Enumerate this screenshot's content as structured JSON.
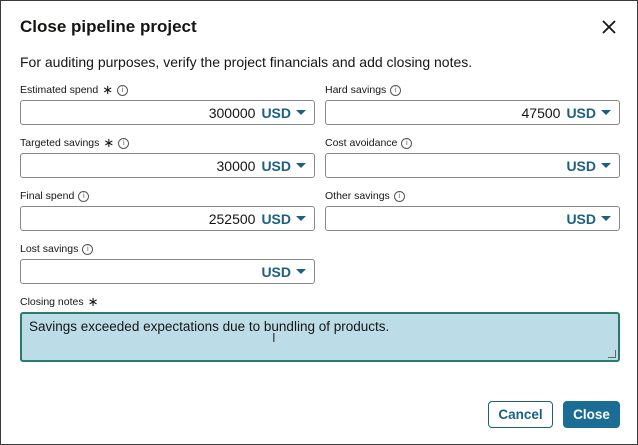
{
  "dialog": {
    "title": "Close pipeline project",
    "subtitle": "For auditing purposes, verify the project financials and add closing notes."
  },
  "fields": {
    "estimated_spend": {
      "label": "Estimated spend",
      "required": "∗",
      "value": "300000",
      "currency": "USD"
    },
    "hard_savings": {
      "label": "Hard savings",
      "value": "47500",
      "currency": "USD"
    },
    "targeted_savings": {
      "label": "Targeted savings",
      "required": "∗",
      "value": "30000",
      "currency": "USD"
    },
    "cost_avoidance": {
      "label": "Cost avoidance",
      "value": "",
      "currency": "USD"
    },
    "final_spend": {
      "label": "Final spend",
      "value": "252500",
      "currency": "USD"
    },
    "other_savings": {
      "label": "Other savings",
      "value": "",
      "currency": "USD"
    },
    "lost_savings": {
      "label": "Lost savings",
      "value": "",
      "currency": "USD"
    }
  },
  "notes": {
    "label": "Closing notes",
    "required": "∗",
    "value": "Savings exceeded expectations due to bundling of products."
  },
  "buttons": {
    "cancel": "Cancel",
    "close": "Close"
  },
  "icons": {
    "info": "i"
  },
  "colors": {
    "accent": "#1b5f83",
    "primary_button": "#1b6d95",
    "notes_bg": "#bcdde8",
    "notes_border": "#2b7a6b"
  }
}
